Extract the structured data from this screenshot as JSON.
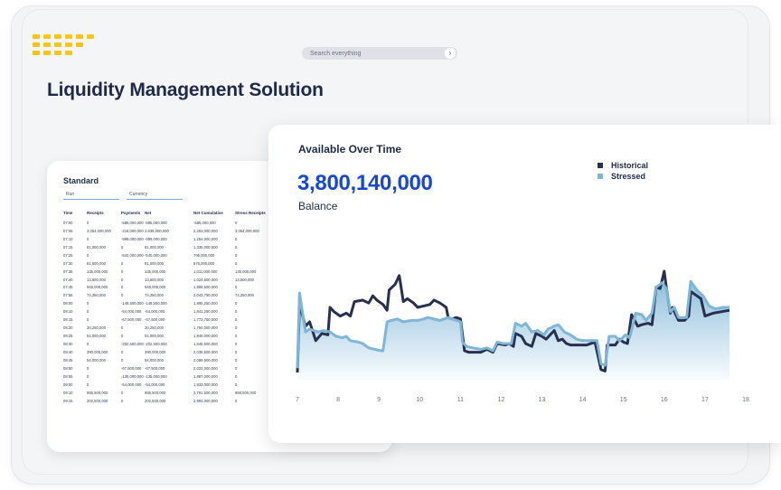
{
  "header": {
    "search_placeholder": "Search everything",
    "search_go": "›",
    "page_title": "Liquidity Management Solution"
  },
  "table": {
    "title": "Standard",
    "tabs": [
      "Run",
      "Currency"
    ],
    "columns": [
      "Time",
      "Receipts",
      "Payments",
      "Net",
      "Net Cumulative",
      "Stress Receipts"
    ],
    "rows": [
      [
        "07:00",
        "0",
        "-585,000,000",
        "-585,000,000",
        "-585,000,000",
        "0"
      ],
      [
        "07:05",
        "3,054,000,000",
        "-216,000,000",
        "2,838,000,000",
        "2,253,000,000",
        "3,054,000,000"
      ],
      [
        "07:10",
        "0",
        "-999,000,000",
        "-999,000,000",
        "1,254,000,000",
        "0"
      ],
      [
        "07:15",
        "81,000,000",
        "0",
        "81,000,000",
        "1,335,000,000",
        "0"
      ],
      [
        "07:25",
        "0",
        "-540,000,000",
        "-540,000,000",
        "795,000,000",
        "0"
      ],
      [
        "07:30",
        "81,000,000",
        "0",
        "81,000,000",
        "876,000,000",
        "0"
      ],
      [
        "07:35",
        "135,000,000",
        "0",
        "135,000,000",
        "1,011,000,000",
        "135,000,000"
      ],
      [
        "07:40",
        "13,500,000",
        "0",
        "13,500,000",
        "1,024,500,000",
        "13,500,000"
      ],
      [
        "07:45",
        "945,000,000",
        "0",
        "945,000,000",
        "1,969,500,000",
        "0"
      ],
      [
        "07:55",
        "74,250,000",
        "0",
        "74,250,000",
        "2,043,750,000",
        "74,250,000"
      ],
      [
        "08:00",
        "0",
        "-148,500,000",
        "-148,500,000",
        "1,895,250,000",
        "0"
      ],
      [
        "08:10",
        "0",
        "-54,000,000",
        "-54,000,000",
        "1,841,250,000",
        "0"
      ],
      [
        "08:15",
        "0",
        "-67,500,000",
        "-67,500,000",
        "1,773,750,000",
        "0"
      ],
      [
        "08:20",
        "20,250,000",
        "0",
        "20,250,000",
        "1,794,000,000",
        "0"
      ],
      [
        "08:25",
        "54,000,000",
        "0",
        "54,000,000",
        "1,848,000,000",
        "0"
      ],
      [
        "08:30",
        "0",
        "-202,500,000",
        "-202,500,000",
        "1,645,500,000",
        "0"
      ],
      [
        "08:40",
        "390,000,000",
        "0",
        "390,000,000",
        "2,035,500,000",
        "0"
      ],
      [
        "08:45",
        "54,000,000",
        "0",
        "54,000,000",
        "2,089,500,000",
        "0"
      ],
      [
        "08:50",
        "0",
        "-67,500,000",
        "-67,500,000",
        "2,022,000,000",
        "0"
      ],
      [
        "08:55",
        "0",
        "-135,000,000",
        "-135,000,000",
        "1,887,000,000",
        "0"
      ],
      [
        "09:00",
        "0",
        "-54,000,000",
        "-54,000,000",
        "1,833,000,000",
        "0"
      ],
      [
        "09:10",
        "958,500,000",
        "0",
        "958,500,000",
        "2,791,500,000",
        "958,500,000"
      ],
      [
        "09:15",
        "202,500,000",
        "0",
        "202,500,000",
        "2,994,000,000",
        "0"
      ]
    ]
  },
  "chart_card": {
    "heading": "Available Over Time",
    "balance_value": "3,800,140,000",
    "balance_label": "Balance"
  },
  "colors": {
    "historical": "#27304f",
    "stressed": "#7fb6d8",
    "accent": "#1647d6",
    "logo": "#f5c518"
  },
  "chart_data": {
    "type": "area",
    "x_ticks": [
      7,
      8,
      9,
      10,
      11,
      12,
      13,
      14,
      15,
      16,
      17,
      18
    ],
    "xlim": [
      7,
      18
    ],
    "ylim": [
      0,
      100
    ],
    "grid": false,
    "legend": "top-right",
    "series": [
      {
        "name": "Historical",
        "color": "#27304f",
        "points": [
          [
            7.0,
            5
          ],
          [
            7.05,
            52
          ],
          [
            7.2,
            37
          ],
          [
            7.3,
            40
          ],
          [
            7.45,
            27
          ],
          [
            7.6,
            32
          ],
          [
            7.75,
            31
          ],
          [
            7.8,
            50
          ],
          [
            7.9,
            47
          ],
          [
            8.05,
            44
          ],
          [
            8.2,
            46
          ],
          [
            8.3,
            44
          ],
          [
            8.4,
            54
          ],
          [
            8.6,
            55
          ],
          [
            8.75,
            53
          ],
          [
            8.85,
            58
          ],
          [
            8.95,
            55
          ],
          [
            9.1,
            52
          ],
          [
            9.2,
            48
          ],
          [
            9.25,
            62
          ],
          [
            9.4,
            66
          ],
          [
            9.5,
            72
          ],
          [
            9.6,
            54
          ],
          [
            9.7,
            56
          ],
          [
            9.85,
            53
          ],
          [
            9.95,
            50
          ],
          [
            10.1,
            51
          ],
          [
            10.25,
            52
          ],
          [
            10.35,
            55
          ],
          [
            10.5,
            53
          ],
          [
            10.65,
            50
          ],
          [
            10.7,
            43
          ],
          [
            10.8,
            42
          ],
          [
            10.9,
            43
          ],
          [
            11.0,
            42
          ],
          [
            11.1,
            20
          ],
          [
            11.2,
            19
          ],
          [
            11.5,
            19
          ],
          [
            11.65,
            21
          ],
          [
            11.8,
            19
          ],
          [
            11.9,
            25
          ],
          [
            12.1,
            24
          ],
          [
            12.2,
            25
          ],
          [
            12.3,
            23
          ],
          [
            12.35,
            32
          ],
          [
            12.5,
            30
          ],
          [
            12.6,
            25
          ],
          [
            12.75,
            23
          ],
          [
            12.85,
            32
          ],
          [
            13.0,
            30
          ],
          [
            13.1,
            28
          ],
          [
            13.3,
            34
          ],
          [
            13.4,
            27
          ],
          [
            13.5,
            28
          ],
          [
            13.6,
            25
          ],
          [
            13.7,
            24
          ],
          [
            13.9,
            24
          ],
          [
            14.1,
            24
          ],
          [
            14.3,
            26
          ],
          [
            14.45,
            7
          ],
          [
            14.55,
            6
          ],
          [
            14.6,
            24
          ],
          [
            14.8,
            24
          ],
          [
            14.9,
            28
          ],
          [
            15.0,
            26
          ],
          [
            15.1,
            25
          ],
          [
            15.2,
            45
          ],
          [
            15.35,
            37
          ],
          [
            15.45,
            38
          ],
          [
            15.6,
            39
          ],
          [
            15.7,
            38
          ],
          [
            15.8,
            64
          ],
          [
            15.9,
            63
          ],
          [
            16.0,
            75
          ],
          [
            16.05,
            64
          ],
          [
            16.15,
            46
          ],
          [
            16.2,
            50
          ],
          [
            16.35,
            41
          ],
          [
            16.5,
            41
          ],
          [
            16.6,
            44
          ],
          [
            16.65,
            61
          ],
          [
            16.8,
            58
          ],
          [
            16.9,
            56
          ],
          [
            17.0,
            44
          ],
          [
            17.2,
            46
          ],
          [
            17.4,
            47
          ],
          [
            17.6,
            48
          ]
        ]
      },
      {
        "name": "Stressed",
        "color": "#7fb6d8",
        "points": [
          [
            7.0,
            8
          ],
          [
            7.05,
            60
          ],
          [
            7.2,
            33
          ],
          [
            7.3,
            35
          ],
          [
            7.5,
            33
          ],
          [
            7.65,
            34
          ],
          [
            7.8,
            33
          ],
          [
            7.95,
            30
          ],
          [
            8.1,
            29
          ],
          [
            8.2,
            30
          ],
          [
            8.3,
            27
          ],
          [
            8.5,
            26
          ],
          [
            8.6,
            25
          ],
          [
            8.75,
            22
          ],
          [
            8.9,
            21
          ],
          [
            9.05,
            20
          ],
          [
            9.1,
            20
          ],
          [
            9.2,
            40
          ],
          [
            9.3,
            41
          ],
          [
            9.45,
            42
          ],
          [
            9.6,
            40
          ],
          [
            9.8,
            41
          ],
          [
            9.95,
            41
          ],
          [
            10.1,
            42
          ],
          [
            10.2,
            43
          ],
          [
            10.35,
            42
          ],
          [
            10.5,
            41
          ],
          [
            10.7,
            43
          ],
          [
            10.8,
            42
          ],
          [
            10.9,
            41
          ],
          [
            11.0,
            40
          ],
          [
            11.05,
            26
          ],
          [
            11.15,
            23
          ],
          [
            11.3,
            22
          ],
          [
            11.5,
            21
          ],
          [
            11.65,
            22
          ],
          [
            11.8,
            20
          ],
          [
            11.9,
            26
          ],
          [
            12.05,
            25
          ],
          [
            12.25,
            25
          ],
          [
            12.35,
            39
          ],
          [
            12.5,
            37
          ],
          [
            12.6,
            39
          ],
          [
            12.75,
            33
          ],
          [
            12.9,
            34
          ],
          [
            13.05,
            31
          ],
          [
            13.15,
            35
          ],
          [
            13.3,
            37
          ],
          [
            13.4,
            38
          ],
          [
            13.55,
            33
          ],
          [
            13.7,
            31
          ],
          [
            13.85,
            28
          ],
          [
            14.0,
            27
          ],
          [
            14.15,
            27
          ],
          [
            14.35,
            27
          ],
          [
            14.45,
            11
          ],
          [
            14.55,
            10
          ],
          [
            14.65,
            30
          ],
          [
            14.8,
            30
          ],
          [
            14.9,
            27
          ],
          [
            15.05,
            31
          ],
          [
            15.15,
            29
          ],
          [
            15.3,
            46
          ],
          [
            15.45,
            45
          ],
          [
            15.55,
            41
          ],
          [
            15.7,
            46
          ],
          [
            15.8,
            64
          ],
          [
            15.95,
            67
          ],
          [
            16.05,
            63
          ],
          [
            16.15,
            47
          ],
          [
            16.25,
            50
          ],
          [
            16.35,
            43
          ],
          [
            16.55,
            43
          ],
          [
            16.65,
            68
          ],
          [
            16.8,
            62
          ],
          [
            16.95,
            58
          ],
          [
            17.1,
            51
          ],
          [
            17.25,
            49
          ],
          [
            17.45,
            50
          ],
          [
            17.6,
            50
          ]
        ]
      }
    ]
  }
}
